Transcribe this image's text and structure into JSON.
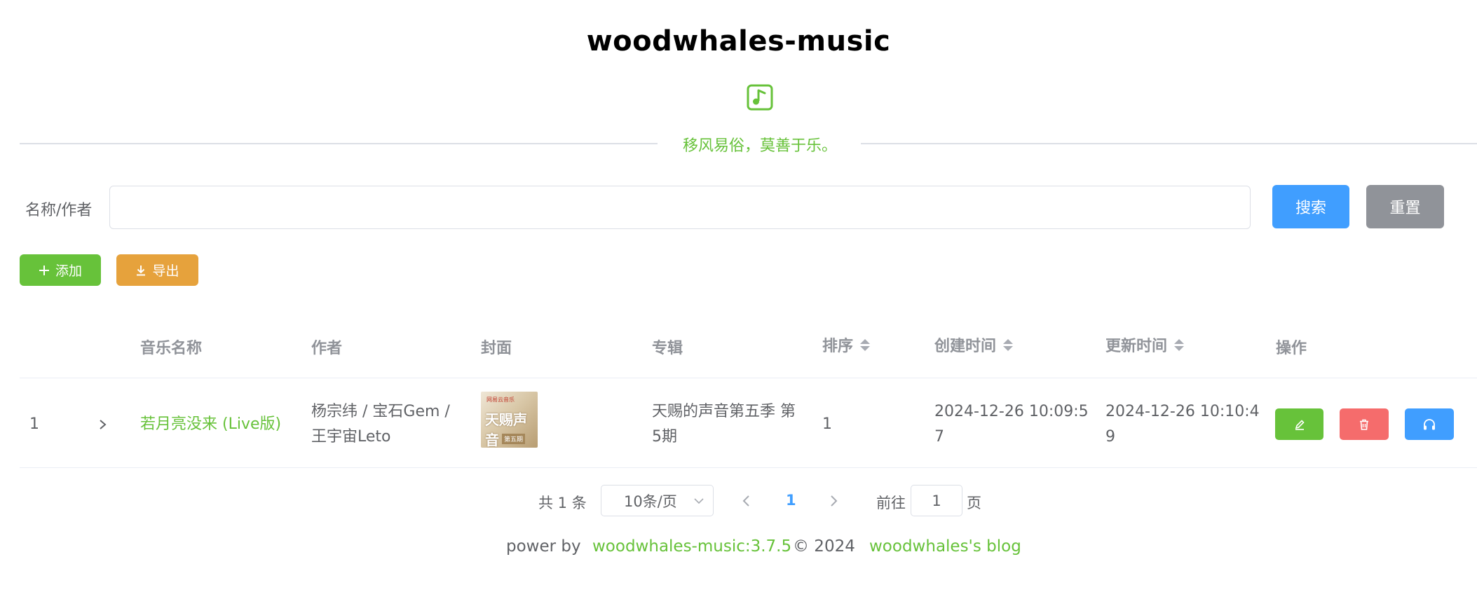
{
  "header": {
    "title": "woodwhales-music",
    "slogan": "移风易俗，莫善于乐。"
  },
  "colors": {
    "primary": "#409eff",
    "success": "#67c23a",
    "warning": "#e6a23c",
    "danger": "#f56c6c",
    "info": "#909399"
  },
  "search": {
    "label": "名称/作者",
    "value": "",
    "placeholder": "",
    "search_label": "搜索",
    "reset_label": "重置"
  },
  "toolbar": {
    "add_label": "添加",
    "export_label": "导出"
  },
  "table": {
    "columns": {
      "name": "音乐名称",
      "artist": "作者",
      "cover": "封面",
      "album": "专辑",
      "sort": "排序",
      "created": "创建时间",
      "updated": "更新时间",
      "actions": "操作"
    },
    "rows": [
      {
        "index": "1",
        "name": "若月亮没来 (Live版)",
        "artist_line1": "杨宗纬 / 宝石Gem /",
        "artist_line2": "王宇宙Leto",
        "cover_text_top": "网易云音乐",
        "cover_text_mid": "天赐声音",
        "cover_text_bot": "第五期",
        "album_line1": "天赐的声音第五季 第",
        "album_line2": "5期",
        "sort": "1",
        "created_line1": "2024-12-26 10:09:5",
        "created_line2": "7",
        "updated_line1": "2024-12-26 10:10:4",
        "updated_line2": "9"
      }
    ]
  },
  "pagination": {
    "total_text": "共 1 条",
    "page_size": "10条/页",
    "current_page": "1",
    "goto_label": "前往",
    "goto_value": "1",
    "goto_unit": "页"
  },
  "footer": {
    "power_by": "power by",
    "version_link": "woodwhales-music:3.7.5",
    "copyright": "©  2024",
    "blog_link": "woodwhales's blog"
  }
}
